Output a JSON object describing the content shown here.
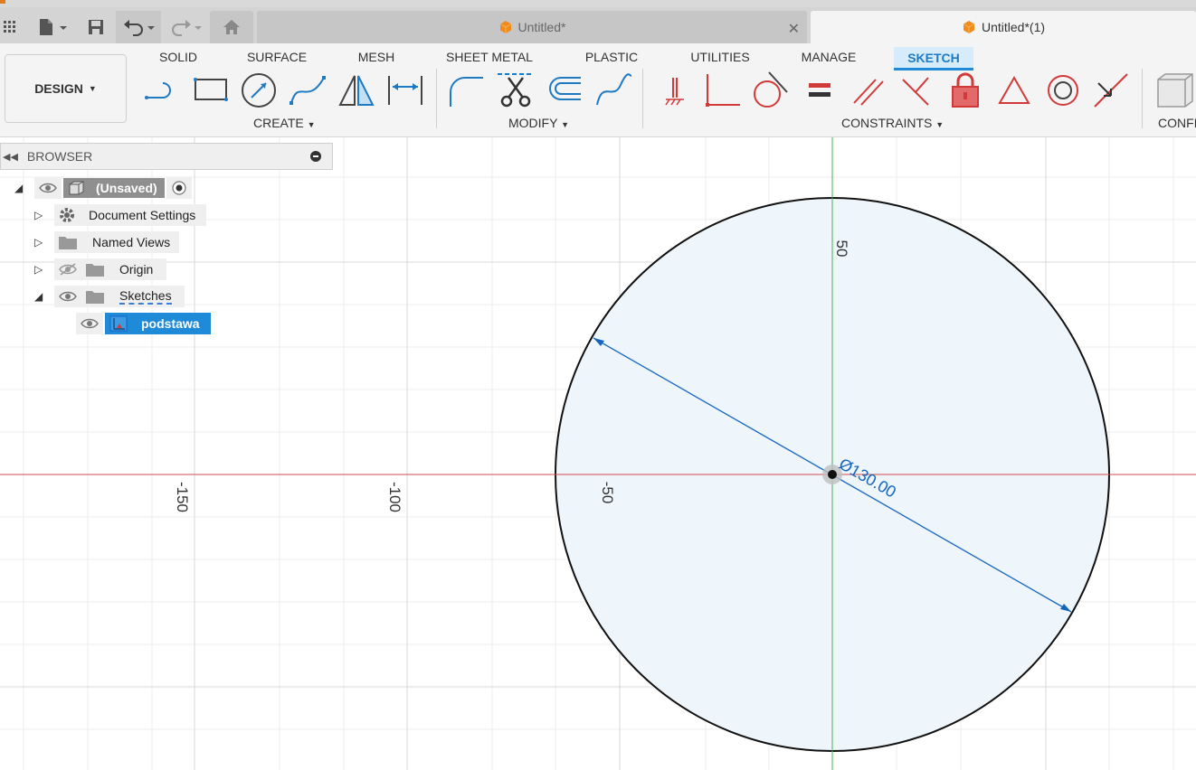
{
  "app": {
    "tabs": [
      {
        "label": "Untitled*",
        "active": false
      },
      {
        "label": "Untitled*(1)",
        "active": true
      }
    ]
  },
  "toolbar": {
    "design_label": "DESIGN",
    "workspace_tabs": [
      "SOLID",
      "SURFACE",
      "MESH",
      "SHEET METAL",
      "PLASTIC",
      "UTILITIES",
      "MANAGE",
      "SKETCH"
    ],
    "active_tab": "SKETCH",
    "groups": {
      "create": "CREATE",
      "modify": "MODIFY",
      "constraints": "CONSTRAINTS",
      "configure": "CONFI"
    }
  },
  "browser": {
    "title": "BROWSER",
    "root": "(Unsaved)",
    "items": [
      "Document Settings",
      "Named Views",
      "Origin",
      "Sketches"
    ],
    "sketch": "podstawa"
  },
  "canvas": {
    "axis_labels": {
      "x_m150": "-150",
      "x_m100": "-100",
      "x_m50": "-50",
      "y_50": "50"
    },
    "dimension": "Ø130.00"
  },
  "colors": {
    "accent": "#1f8ad8",
    "x_axis": "#d24b4b",
    "y_axis": "#4caf50",
    "circle_fill": "#eef6fc",
    "dimension": "#1565c0",
    "constraint_red": "#d23a3a"
  }
}
